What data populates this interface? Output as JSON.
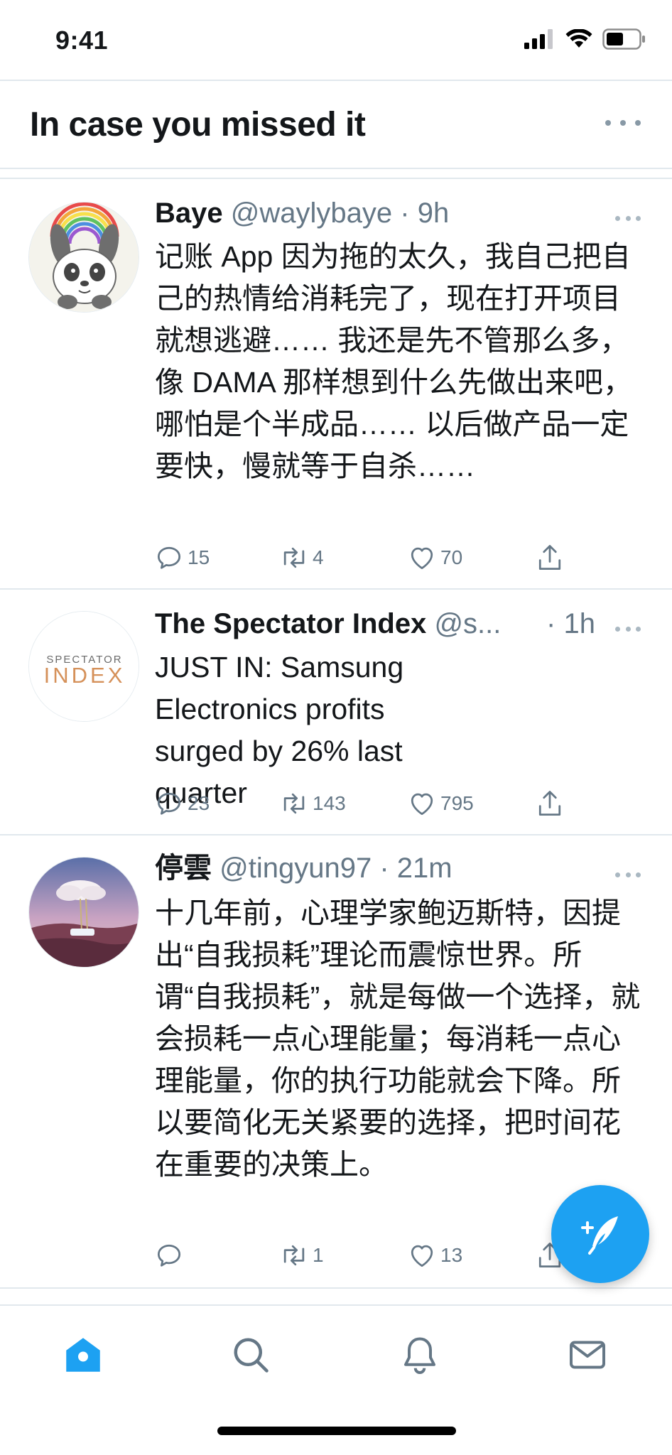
{
  "status_bar": {
    "time": "9:41"
  },
  "header": {
    "title": "In case you missed it"
  },
  "tweets": [
    {
      "name": "Baye",
      "handle": "@waylybaye",
      "separator": "·",
      "time": "9h",
      "text": "记账 App 因为拖的太久，我自己把自己的热情给消耗完了，现在打开项目就想逃避…… 我还是先不管那么多，像 DAMA 那样想到什么先做出来吧，哪怕是个半成品…… 以后做产品一定要快，慢就等于自杀……",
      "replies": "15",
      "retweets": "4",
      "likes": "70"
    },
    {
      "name": "The Spectator Index",
      "handle": "@s...",
      "separator": "·",
      "time": "1h",
      "text": "JUST IN: Samsung Electronics profits surged by 26% last quarter",
      "replies": "23",
      "retweets": "143",
      "likes": "795",
      "avatar_logo_top": "SPECTATOR",
      "avatar_logo_bottom": "INDEX"
    },
    {
      "name": "停雲",
      "handle": "@tingyun97",
      "separator": "·",
      "time": "21m",
      "text": "十几年前，心理学家鲍迈斯特，因提出“自我损耗”理论而震惊世界。所谓“自我损耗”，就是每做一个选择，就会损耗一点心理能量；每消耗一点心理能量，你的执行功能就会下降。所以要简化无关紧要的选择，把时间花在重要的决策上。",
      "replies": "",
      "retweets": "1",
      "likes": "13"
    }
  ],
  "colors": {
    "accent": "#1da1f2",
    "text_primary": "#14171a",
    "text_secondary": "#657786",
    "divider": "#e1e8ed"
  },
  "icons": {
    "reply": "reply-icon",
    "retweet": "retweet-icon",
    "like": "heart-icon",
    "share": "share-icon",
    "compose": "compose-tweet-icon",
    "tabs": [
      "home-icon",
      "search-icon",
      "notifications-icon",
      "messages-icon"
    ]
  }
}
